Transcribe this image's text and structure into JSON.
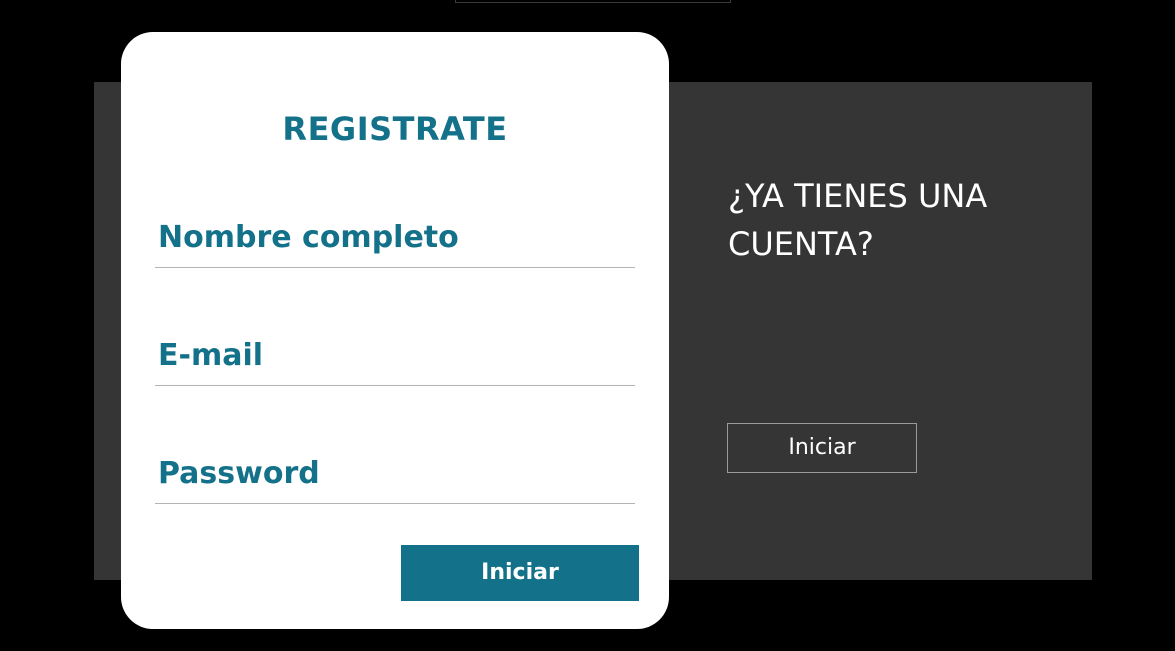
{
  "register": {
    "title": "REGISTRATE",
    "fields": [
      {
        "placeholder": "Nombre completo",
        "value": ""
      },
      {
        "placeholder": "E-mail",
        "value": ""
      },
      {
        "placeholder": "Password",
        "value": ""
      }
    ],
    "submit_label": "Iniciar"
  },
  "side": {
    "heading": "¿YA TIENES UNA CUENTA?",
    "button_label": "Iniciar"
  },
  "colors": {
    "accent": "#14718a",
    "panel": "#353535",
    "background": "#000000",
    "card": "#ffffff"
  }
}
